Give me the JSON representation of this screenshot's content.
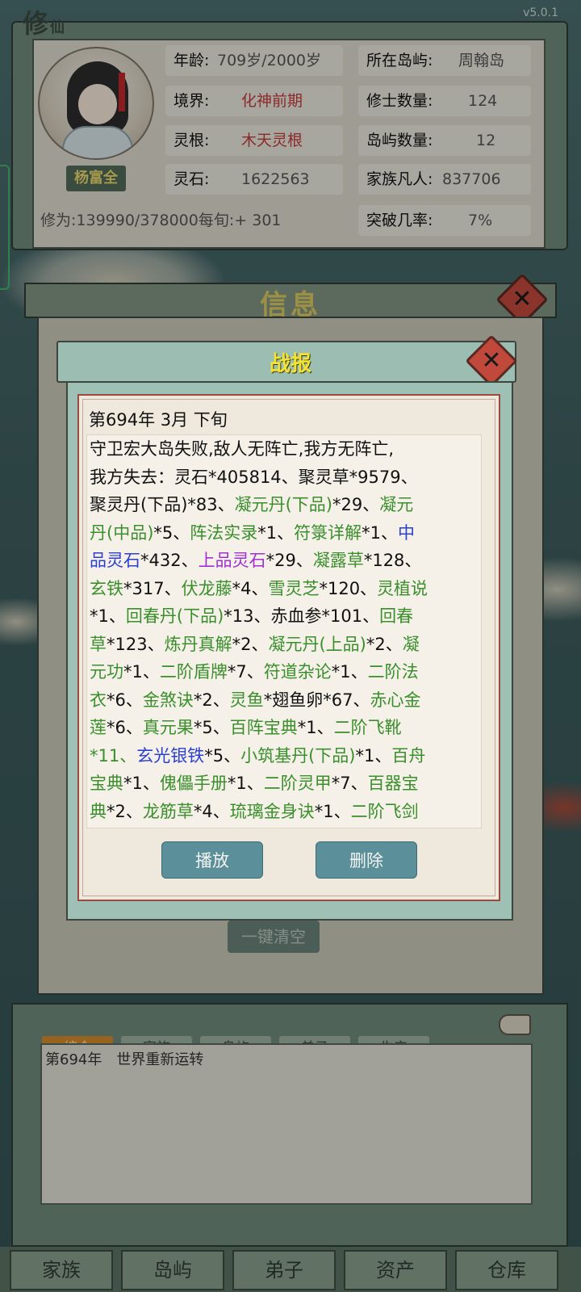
{
  "app": {
    "logo_main": "修",
    "logo_sub": "仙",
    "version": "v5.0.1"
  },
  "profile": {
    "name": "杨富全",
    "age_label": "年龄:",
    "age_value": "709岁/2000岁",
    "realm_label": "境界:",
    "realm_value": "化神前期",
    "root_label": "灵根:",
    "root_value": "木天灵根",
    "stone_label": "灵石:",
    "stone_value": "1622563",
    "island_label": "所在岛屿:",
    "island_value": "周翰岛",
    "cultivator_label": "修士数量:",
    "cultivator_value": "124",
    "island_count_label": "岛屿数量:",
    "island_count_value": "12",
    "mortal_label": "家族凡人:",
    "mortal_value": "837706",
    "cultivation_text": "修为:139990/378000每旬:+ 301",
    "breakthrough_label": "突破几率:",
    "breakthrough_value": "7%"
  },
  "info_panel": {
    "title": "信息",
    "clear_all_label": "一键清空"
  },
  "battle_report": {
    "title": "战报",
    "date": "第694年 3月 下旬",
    "lines": [
      [
        {
          "t": "守卫宏大岛失败,敌人无阵亡,我方无阵亡,",
          "c": "k"
        }
      ],
      [
        {
          "t": "我方失去：灵石*405814、聚灵草*9579、",
          "c": "k"
        }
      ],
      [
        {
          "t": "聚灵丹(下品)*83、",
          "c": "k"
        },
        {
          "t": "凝元丹(下品)",
          "c": "g"
        },
        {
          "t": "*29、",
          "c": "k"
        },
        {
          "t": "凝元",
          "c": "g"
        }
      ],
      [
        {
          "t": "丹(中品)",
          "c": "g"
        },
        {
          "t": "*5、",
          "c": "k"
        },
        {
          "t": "阵法实录",
          "c": "g"
        },
        {
          "t": "*1、",
          "c": "k"
        },
        {
          "t": "符箓详解",
          "c": "g"
        },
        {
          "t": "*1、",
          "c": "k"
        },
        {
          "t": "中",
          "c": "b"
        }
      ],
      [
        {
          "t": "品灵石",
          "c": "b"
        },
        {
          "t": "*432、",
          "c": "k"
        },
        {
          "t": "上品灵石",
          "c": "p"
        },
        {
          "t": "*29、",
          "c": "k"
        },
        {
          "t": "凝露草",
          "c": "g"
        },
        {
          "t": "*128、",
          "c": "k"
        }
      ],
      [
        {
          "t": "玄铁",
          "c": "g"
        },
        {
          "t": "*317、",
          "c": "k"
        },
        {
          "t": "伏龙藤",
          "c": "g"
        },
        {
          "t": "*4、",
          "c": "k"
        },
        {
          "t": "雪灵芝",
          "c": "g"
        },
        {
          "t": "*120、",
          "c": "k"
        },
        {
          "t": "灵植说",
          "c": "g"
        }
      ],
      [
        {
          "t": "*1、",
          "c": "k"
        },
        {
          "t": "回春丹(下品)",
          "c": "g"
        },
        {
          "t": "*13、赤血参*101、",
          "c": "k"
        },
        {
          "t": "回春",
          "c": "g"
        }
      ],
      [
        {
          "t": "草",
          "c": "g"
        },
        {
          "t": "*123、",
          "c": "k"
        },
        {
          "t": "炼丹真解",
          "c": "g"
        },
        {
          "t": "*2、",
          "c": "k"
        },
        {
          "t": "凝元丹(上品)",
          "c": "g"
        },
        {
          "t": "*2、",
          "c": "k"
        },
        {
          "t": "凝",
          "c": "g"
        }
      ],
      [
        {
          "t": "元功",
          "c": "g"
        },
        {
          "t": "*1、",
          "c": "k"
        },
        {
          "t": "二阶盾牌",
          "c": "g"
        },
        {
          "t": "*7、",
          "c": "k"
        },
        {
          "t": "符道杂论",
          "c": "g"
        },
        {
          "t": "*1、",
          "c": "k"
        },
        {
          "t": "二阶法",
          "c": "g"
        }
      ],
      [
        {
          "t": "衣",
          "c": "g"
        },
        {
          "t": "*6、",
          "c": "k"
        },
        {
          "t": "金煞诀",
          "c": "g"
        },
        {
          "t": "*2、",
          "c": "k"
        },
        {
          "t": "灵鱼",
          "c": "g"
        },
        {
          "t": "*翅鱼卵*67、",
          "c": "k"
        },
        {
          "t": "赤心金",
          "c": "g"
        }
      ],
      [
        {
          "t": "莲",
          "c": "g"
        },
        {
          "t": "*6、",
          "c": "k"
        },
        {
          "t": "真元果",
          "c": "g"
        },
        {
          "t": "*5、",
          "c": "k"
        },
        {
          "t": "百阵宝典",
          "c": "g"
        },
        {
          "t": "*1、",
          "c": "k"
        },
        {
          "t": "二阶飞靴",
          "c": "g"
        }
      ],
      [
        {
          "t": "*11、",
          "c": "g"
        },
        {
          "t": "玄光银铁",
          "c": "b"
        },
        {
          "t": "*5、",
          "c": "k"
        },
        {
          "t": "小筑基丹(下品)",
          "c": "g"
        },
        {
          "t": "*1、",
          "c": "k"
        },
        {
          "t": "百舟",
          "c": "g"
        }
      ],
      [
        {
          "t": "宝典",
          "c": "g"
        },
        {
          "t": "*1、",
          "c": "k"
        },
        {
          "t": "傀儡手册",
          "c": "g"
        },
        {
          "t": "*1、",
          "c": "k"
        },
        {
          "t": "二阶灵甲",
          "c": "g"
        },
        {
          "t": "*7、",
          "c": "k"
        },
        {
          "t": "百器宝",
          "c": "g"
        }
      ],
      [
        {
          "t": "典",
          "c": "g"
        },
        {
          "t": "*2、",
          "c": "k"
        },
        {
          "t": "龙筋草",
          "c": "g"
        },
        {
          "t": "*4、",
          "c": "k"
        },
        {
          "t": "琉璃金身诀",
          "c": "g"
        },
        {
          "t": "*1、",
          "c": "k"
        },
        {
          "t": "二阶飞剑",
          "c": "g"
        }
      ]
    ],
    "play_label": "播放",
    "delete_label": "删除"
  },
  "colors": {
    "green": "#3a8f2c",
    "blue": "#2b3fd1",
    "purple": "#a12fd3",
    "title_yellow": "#f3e330"
  },
  "log": {
    "tabs": [
      "综合",
      "家族",
      "岛屿",
      "弟子",
      "生产"
    ],
    "active_tab": "综合",
    "entries": [
      "第694年　世界重新运转"
    ]
  },
  "bottom_nav": [
    "家族",
    "岛屿",
    "弟子",
    "资产",
    "仓库"
  ]
}
